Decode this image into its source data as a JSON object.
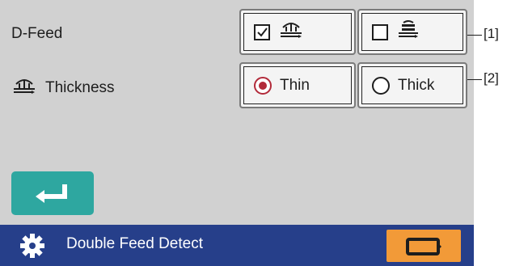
{
  "settings": {
    "dfeed_label": "D-Feed",
    "thickness_label": "Thickness"
  },
  "buttons": {
    "dfeed_on": {
      "checked": true,
      "icon": "paper-feed-icon"
    },
    "dfeed_off": {
      "checked": false,
      "icon": "paper-stack-icon"
    },
    "thin_label": "Thin",
    "thin_selected": true,
    "thick_label": "Thick",
    "thick_selected": false
  },
  "callouts": [
    "[1]",
    "[2]"
  ],
  "footer": {
    "title": "Double Feed Detect",
    "left_icon": "gear-icon",
    "right_icon": "battery-arrow-icon"
  },
  "icons": {
    "enter": "enter-return-icon"
  },
  "colors": {
    "screen_bg": "#d1d1d1",
    "footer_bg": "#263f8a",
    "enter_button": "#2ea7a0",
    "orange_button": "#f29a38",
    "radio_selected": "#b22a3a"
  }
}
